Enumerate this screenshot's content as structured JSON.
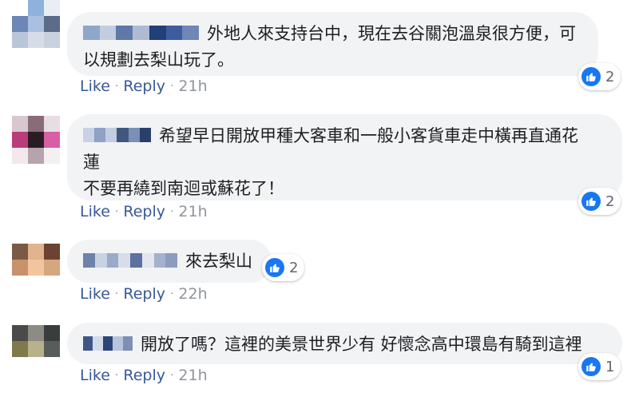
{
  "comments": [
    {
      "text": "外地人來支持台中，現在去谷關泡溫泉很方便，可\n以規劃去梨山玩了。",
      "reaction_count": "2",
      "like": "Like",
      "reply": "Reply",
      "time": "21h",
      "avatar_colors": [
        "#ffffff",
        "#8fb2dc",
        "#e9eef4",
        "#6d86b5",
        "#a9c0de",
        "#5b6c88",
        "#b9c6d8",
        "#d7dde8",
        "#c9d1dd"
      ],
      "name_colors": [
        "#8ea7c9",
        "#c2cde0",
        "#5e78a8",
        "#aebbd2",
        "#233f7a",
        "#3b5d9e",
        "#6f86b6"
      ]
    },
    {
      "text": "希望早日開放甲種大客車和一般小客貨車走中橫再直通花\n蓮\n不要再繞到南迴或蘇花了！",
      "reaction_count": "2",
      "like": "Like",
      "reply": "Reply",
      "time": "21h",
      "avatar_colors": [
        "#d8c7cf",
        "#8a6b7a",
        "#e8dde2",
        "#b93d78",
        "#2b1c24",
        "#d85fa3",
        "#f1e9ed",
        "#b6a3ac",
        "#f4f0f2"
      ],
      "name_colors": [
        "#c8d2e4",
        "#8fa1c5",
        "#c3cde0",
        "#41577f",
        "#7d8fb5",
        "#2a3f69"
      ]
    },
    {
      "text": "來去梨山",
      "reaction_count": "2",
      "like": "Like",
      "reply": "Reply",
      "time": "22h",
      "avatar_colors": [
        "#7a5a45",
        "#e2b48d",
        "#6b4330",
        "#c8926b",
        "#f2c59e",
        "#d6a67f",
        "#b9a393",
        "#e6cbb2",
        "#d9b89b"
      ],
      "name_colors": [
        "#6e82aa",
        "#c9d2e2",
        "#9aaac8",
        "#d7dde9",
        "#5c71a0",
        "#e1e6ef",
        "#a4b2cd",
        "#8c9cbd"
      ]
    },
    {
      "text": "開放了嗎？這裡的美景世界少有 好懷念高中環島有騎到這裡",
      "reaction_count": "1",
      "like": "Like",
      "reply": "Reply",
      "time": "21h",
      "avatar_colors": [
        "#4a4a4a",
        "#8c8c82",
        "#3a3d3e",
        "#7f7a4c",
        "#b7b28a",
        "#585c5a",
        "#a9a69a",
        "#d6d3c6",
        "#cfcfc7"
      ],
      "name_colors": [
        "#3f5787",
        "#d3dbe8",
        "#2c4477",
        "#b8c4da",
        "#7d8fb5"
      ]
    }
  ],
  "colors": {
    "link": "#385898",
    "meta": "#90949c",
    "like_blue": "#1877f2",
    "bubble": "#f2f3f5"
  }
}
